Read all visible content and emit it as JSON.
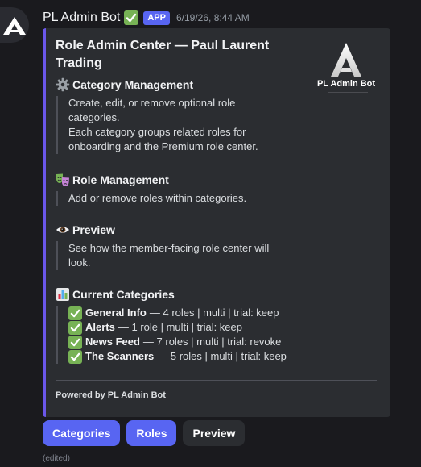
{
  "message": {
    "username": "PL Admin Bot",
    "badge": "APP",
    "timestamp": "6/19/26, 8:44 AM",
    "edited_label": "(edited)"
  },
  "embed": {
    "accent_color": "#6b57ea",
    "title": "Role Admin Center — Paul Laurent Trading",
    "thumbnail_text": "PL Admin Bot",
    "fields": [
      {
        "icon": "gear-icon",
        "name": "Category Management",
        "lines": [
          "Create, edit, or remove optional role categories.",
          "Each category groups related roles for onboarding and the Premium role center."
        ]
      },
      {
        "icon": "masks-icon",
        "name": "Role Management",
        "lines": [
          "Add or remove roles within categories."
        ]
      },
      {
        "icon": "eye-icon",
        "name": "Preview",
        "lines": [
          "See how the member-facing role center will look."
        ]
      },
      {
        "icon": "bar-chart-icon",
        "name": "Current Categories",
        "categories": [
          {
            "name": "General Info",
            "detail": "— 4 roles | multi | trial: keep"
          },
          {
            "name": "Alerts",
            "detail": "— 1 role | multi | trial: keep"
          },
          {
            "name": "News Feed",
            "detail": "— 7 roles | multi | trial: revoke"
          },
          {
            "name": "The Scanners",
            "detail": "— 5 roles | multi | trial: keep"
          }
        ]
      }
    ],
    "footer": "Powered by PL Admin Bot"
  },
  "buttons": {
    "categories": "Categories",
    "roles": "Roles",
    "preview": "Preview"
  },
  "colors": {
    "background": "#1a1a1e",
    "embed_bg": "#2b2d31",
    "blurple": "#5865f2",
    "check_green": "#77b255"
  }
}
